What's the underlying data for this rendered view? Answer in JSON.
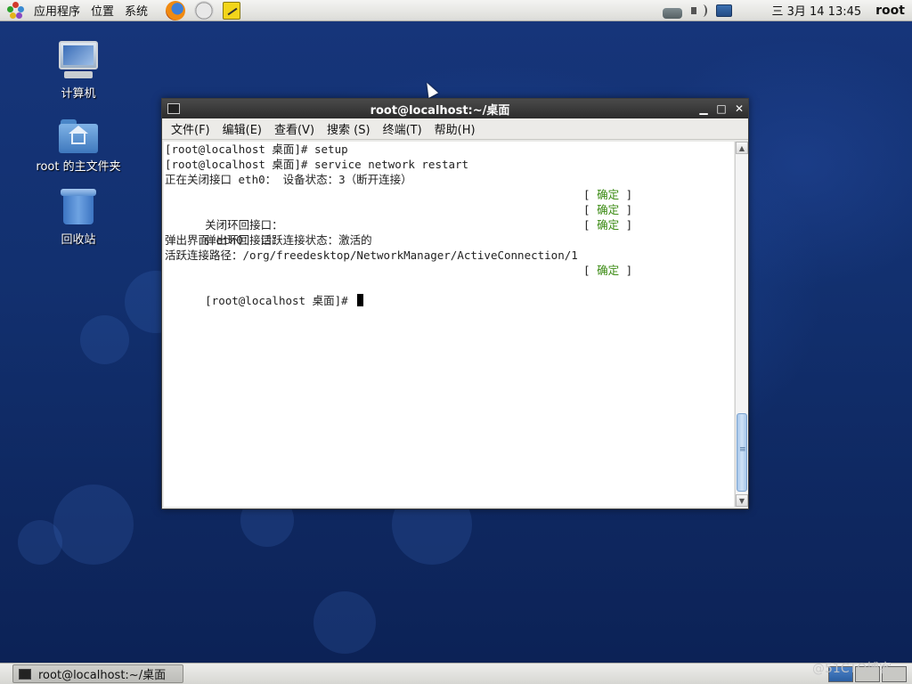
{
  "top_panel": {
    "menus": [
      "应用程序",
      "位置",
      "系统"
    ],
    "clock": "三 3月 14 13:45",
    "user": "root"
  },
  "desktop_icons": [
    {
      "label": "计算机"
    },
    {
      "label": "root 的主文件夹"
    },
    {
      "label": "回收站"
    }
  ],
  "terminal": {
    "title": "root@localhost:~/桌面",
    "menu": [
      "文件(F)",
      "编辑(E)",
      "查看(V)",
      "搜索 (S)",
      "终端(T)",
      "帮助(H)"
    ],
    "ok_text": "确定",
    "lines": [
      "[root@localhost 桌面]# setup",
      "[root@localhost 桌面]# service network restart",
      "正在关闭接口 eth0： 设备状态：3（断开连接）",
      "",
      "关闭环回接口：",
      "弹出环回接口：",
      "弹出界面 eth0： 活跃连接状态：激活的",
      "活跃连接路径：/org/freedesktop/NetworkManager/ActiveConnection/1",
      "",
      "[root@localhost 桌面]# "
    ]
  },
  "taskbar": {
    "task_label": "root@localhost:~/桌面"
  },
  "watermark": "@51CTO博客",
  "colors": {
    "ok_green": "#3a8a12",
    "desktop_blue": "#12306f"
  }
}
